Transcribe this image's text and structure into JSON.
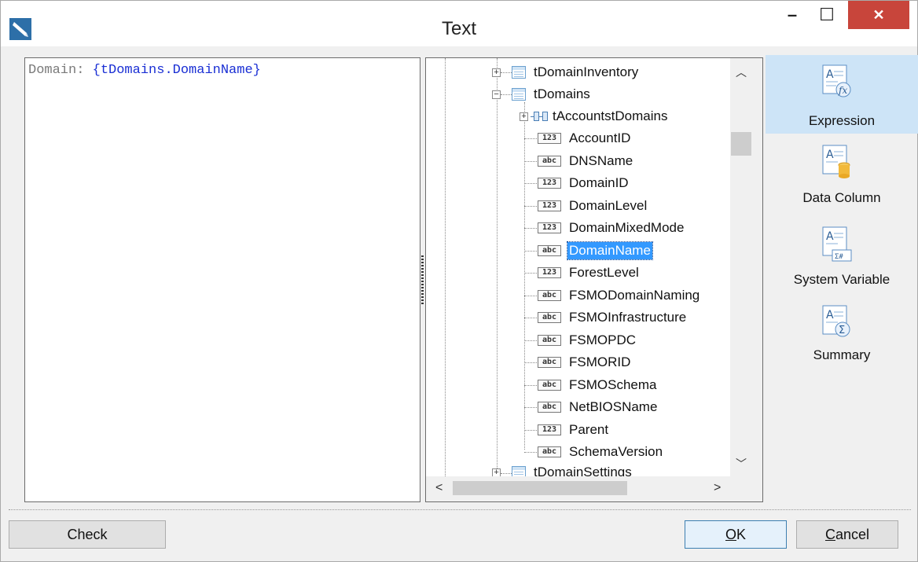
{
  "window": {
    "title": "Text"
  },
  "titlebar": {
    "min_glyph": "–",
    "max_glyph": "☐",
    "close_glyph": "✕"
  },
  "editor": {
    "label": "Domain:",
    "field": "{tDomains.DomainName}"
  },
  "tree": {
    "tables": [
      {
        "name": "tDomainInventory",
        "expander": "+"
      },
      {
        "name": "tDomains",
        "expander": "−"
      },
      {
        "name": "tDomainSettings",
        "expander": "+"
      }
    ],
    "relation": {
      "name": "tAccountstDomains",
      "expander": "+"
    },
    "fields": [
      {
        "type": "123",
        "name": "AccountID"
      },
      {
        "type": "abc",
        "name": "DNSName"
      },
      {
        "type": "123",
        "name": "DomainID"
      },
      {
        "type": "123",
        "name": "DomainLevel"
      },
      {
        "type": "123",
        "name": "DomainMixedMode"
      },
      {
        "type": "abc",
        "name": "DomainName",
        "selected": true
      },
      {
        "type": "123",
        "name": "ForestLevel"
      },
      {
        "type": "abc",
        "name": "FSMODomainNaming"
      },
      {
        "type": "abc",
        "name": "FSMOInfrastructure"
      },
      {
        "type": "abc",
        "name": "FSMOPDC"
      },
      {
        "type": "abc",
        "name": "FSMORID"
      },
      {
        "type": "abc",
        "name": "FSMOSchema"
      },
      {
        "type": "abc",
        "name": "NetBIOSName"
      },
      {
        "type": "123",
        "name": "Parent"
      },
      {
        "type": "abc",
        "name": "SchemaVersion"
      }
    ]
  },
  "sidebar": {
    "items": [
      {
        "label": "Expression",
        "icon": "expression-icon",
        "active": true
      },
      {
        "label": "Data Column",
        "icon": "data-column-icon"
      },
      {
        "label": "System Variable",
        "icon": "system-variable-icon"
      },
      {
        "label": "Summary",
        "icon": "summary-icon"
      }
    ]
  },
  "buttons": {
    "check": "Check",
    "ok_mnemonic": "O",
    "ok_rest": "K",
    "cancel_mnemonic": "C",
    "cancel_rest": "ancel"
  },
  "colors": {
    "accent": "#3399ff",
    "close": "#c8453b",
    "active_tab": "#cde4f7",
    "field_text": "#1a2fd4"
  }
}
